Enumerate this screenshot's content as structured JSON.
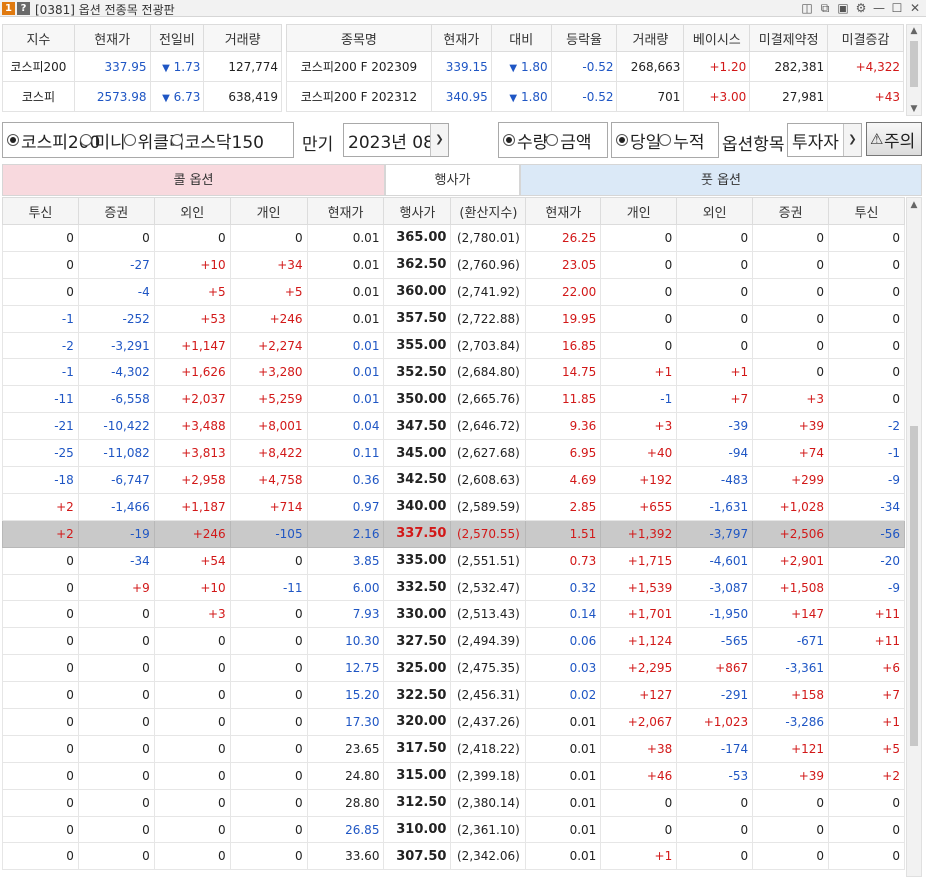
{
  "window": {
    "badge_one": "1",
    "badge_help": "?",
    "title": "[0381] 옵션 전종목 전광판",
    "icons": [
      "document-icon",
      "copy-icon",
      "camera-icon",
      "gear-icon",
      "minimize-icon",
      "maximize-icon",
      "close-icon"
    ]
  },
  "index_table": {
    "headers": [
      "지수",
      "현재가",
      "전일비",
      "거래량"
    ],
    "rows": [
      {
        "name": "코스피200",
        "price": "337.95",
        "change": "1.73",
        "volume": "127,774"
      },
      {
        "name": "코스피",
        "price": "2573.98",
        "change": "6.73",
        "volume": "638,419"
      }
    ]
  },
  "futures_table": {
    "headers": [
      "종목명",
      "현재가",
      "대비",
      "등락율",
      "거래량",
      "베이시스",
      "미결제약정",
      "미결증감"
    ],
    "rows": [
      {
        "name": "코스피200 F 202309",
        "price": "339.15",
        "change": "1.80",
        "rate": "-0.52",
        "volume": "268,663",
        "basis": "+1.20",
        "oi": "282,381",
        "oi_change": "+4,322"
      },
      {
        "name": "코스피200 F 202312",
        "price": "340.95",
        "change": "1.80",
        "rate": "-0.52",
        "volume": "701",
        "basis": "+3.00",
        "oi": "27,981",
        "oi_change": "+43"
      }
    ]
  },
  "filters": {
    "market_options": [
      "코스피200",
      "미니",
      "위클리",
      "코스닥150"
    ],
    "market_selected": 0,
    "expiry_label": "만기",
    "expiry_value": "2023년 08",
    "unit_options": [
      "수량",
      "금액"
    ],
    "unit_selected": 0,
    "period_options": [
      "당일",
      "누적"
    ],
    "period_selected": 0,
    "item_label": "옵션항목",
    "item_value": "투자자",
    "warn_label": "주의"
  },
  "board": {
    "call_title": "콜 옵션",
    "strike_title": "행사가",
    "put_title": "풋 옵션",
    "columns": [
      "투신",
      "증권",
      "외인",
      "개인",
      "현재가",
      "행사가",
      "(환산지수)",
      "현재가",
      "개인",
      "외인",
      "증권",
      "투신"
    ],
    "highlight_row": 11,
    "rows": [
      [
        "0",
        "0",
        "0",
        "0",
        "0.01",
        "365.00",
        "(2,780.01)",
        "26.25",
        "0",
        "0",
        "0",
        "0"
      ],
      [
        "0",
        "-27",
        "+10",
        "+34",
        "0.01",
        "362.50",
        "(2,760.96)",
        "23.05",
        "0",
        "0",
        "0",
        "0"
      ],
      [
        "0",
        "-4",
        "+5",
        "+5",
        "0.01",
        "360.00",
        "(2,741.92)",
        "22.00",
        "0",
        "0",
        "0",
        "0"
      ],
      [
        "-1",
        "-252",
        "+53",
        "+246",
        "0.01",
        "357.50",
        "(2,722.88)",
        "19.95",
        "0",
        "0",
        "0",
        "0"
      ],
      [
        "-2",
        "-3,291",
        "+1,147",
        "+2,274",
        "0.01",
        "355.00",
        "(2,703.84)",
        "16.85",
        "0",
        "0",
        "0",
        "0"
      ],
      [
        "-1",
        "-4,302",
        "+1,626",
        "+3,280",
        "0.01",
        "352.50",
        "(2,684.80)",
        "14.75",
        "+1",
        "+1",
        "0",
        "0"
      ],
      [
        "-11",
        "-6,558",
        "+2,037",
        "+5,259",
        "0.01",
        "350.00",
        "(2,665.76)",
        "11.85",
        "-1",
        "+7",
        "+3",
        "0"
      ],
      [
        "-21",
        "-10,422",
        "+3,488",
        "+8,001",
        "0.04",
        "347.50",
        "(2,646.72)",
        "9.36",
        "+3",
        "-39",
        "+39",
        "-2"
      ],
      [
        "-25",
        "-11,082",
        "+3,813",
        "+8,422",
        "0.11",
        "345.00",
        "(2,627.68)",
        "6.95",
        "+40",
        "-94",
        "+74",
        "-1"
      ],
      [
        "-18",
        "-6,747",
        "+2,958",
        "+4,758",
        "0.36",
        "342.50",
        "(2,608.63)",
        "4.69",
        "+192",
        "-483",
        "+299",
        "-9"
      ],
      [
        "+2",
        "-1,466",
        "+1,187",
        "+714",
        "0.97",
        "340.00",
        "(2,589.59)",
        "2.85",
        "+655",
        "-1,631",
        "+1,028",
        "-34"
      ],
      [
        "+2",
        "-19",
        "+246",
        "-105",
        "2.16",
        "337.50",
        "(2,570.55)",
        "1.51",
        "+1,392",
        "-3,797",
        "+2,506",
        "-56"
      ],
      [
        "0",
        "-34",
        "+54",
        "0",
        "3.85",
        "335.00",
        "(2,551.51)",
        "0.73",
        "+1,715",
        "-4,601",
        "+2,901",
        "-20"
      ],
      [
        "0",
        "+9",
        "+10",
        "-11",
        "6.00",
        "332.50",
        "(2,532.47)",
        "0.32",
        "+1,539",
        "-3,087",
        "+1,508",
        "-9"
      ],
      [
        "0",
        "0",
        "+3",
        "0",
        "7.93",
        "330.00",
        "(2,513.43)",
        "0.14",
        "+1,701",
        "-1,950",
        "+147",
        "+11"
      ],
      [
        "0",
        "0",
        "0",
        "0",
        "10.30",
        "327.50",
        "(2,494.39)",
        "0.06",
        "+1,124",
        "-565",
        "-671",
        "+11"
      ],
      [
        "0",
        "0",
        "0",
        "0",
        "12.75",
        "325.00",
        "(2,475.35)",
        "0.03",
        "+2,295",
        "+867",
        "-3,361",
        "+6"
      ],
      [
        "0",
        "0",
        "0",
        "0",
        "15.20",
        "322.50",
        "(2,456.31)",
        "0.02",
        "+127",
        "-291",
        "+158",
        "+7"
      ],
      [
        "0",
        "0",
        "0",
        "0",
        "17.30",
        "320.00",
        "(2,437.26)",
        "0.01",
        "+2,067",
        "+1,023",
        "-3,286",
        "+1"
      ],
      [
        "0",
        "0",
        "0",
        "0",
        "23.65",
        "317.50",
        "(2,418.22)",
        "0.01",
        "+38",
        "-174",
        "+121",
        "+5"
      ],
      [
        "0",
        "0",
        "0",
        "0",
        "24.80",
        "315.00",
        "(2,399.18)",
        "0.01",
        "+46",
        "-53",
        "+39",
        "+2"
      ],
      [
        "0",
        "0",
        "0",
        "0",
        "28.80",
        "312.50",
        "(2,380.14)",
        "0.01",
        "0",
        "0",
        "0",
        "0"
      ],
      [
        "0",
        "0",
        "0",
        "0",
        "26.85",
        "310.00",
        "(2,361.10)",
        "0.01",
        "0",
        "0",
        "0",
        "0"
      ],
      [
        "0",
        "0",
        "0",
        "0",
        "33.60",
        "307.50",
        "(2,342.06)",
        "0.01",
        "+1",
        "0",
        "0",
        "0"
      ]
    ],
    "call_price_colors": [
      "blk",
      "blk",
      "blk",
      "blk",
      "blue",
      "blue",
      "blue",
      "blue",
      "blue",
      "blue",
      "blue",
      "blue",
      "blue",
      "blue",
      "blue",
      "blue",
      "blue",
      "blue",
      "blue",
      "blk",
      "blk",
      "blk",
      "blue",
      "blk"
    ],
    "put_price_colors": [
      "red",
      "red",
      "red",
      "red",
      "red",
      "red",
      "red",
      "red",
      "red",
      "red",
      "red",
      "red",
      "red",
      "blue",
      "blue",
      "blue",
      "blue",
      "blue",
      "blk",
      "blk",
      "blk",
      "blk",
      "blk",
      "blk"
    ]
  },
  "colors": {
    "up": "#d21818",
    "down": "#1f56c4",
    "highlight": "#c9c9c9",
    "call_header": "#f8d9de",
    "put_header": "#dbe9f7"
  }
}
